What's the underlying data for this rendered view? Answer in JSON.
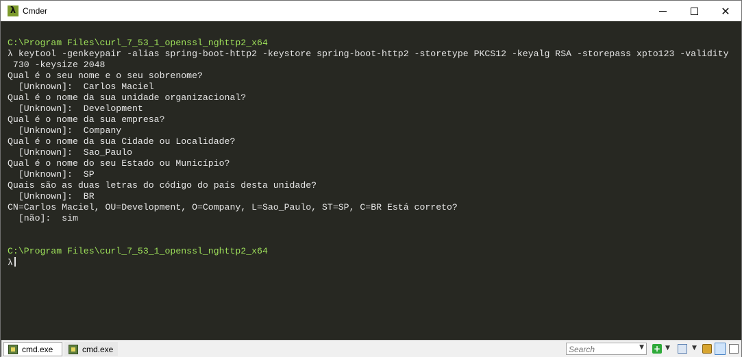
{
  "window": {
    "title": "Cmder",
    "app_icon": "lambda-icon",
    "controls": [
      "minimize-icon",
      "maximize-icon",
      "close-icon"
    ]
  },
  "terminal": {
    "lines": [
      {
        "text": "C:\\Program Files\\curl_7_53_1_openssl_nghttp2_x64",
        "kind": "path"
      },
      {
        "text": "λ keytool -genkeypair -alias spring-boot-http2 -keystore spring-boot-http2 -storetype PKCS12 -keyalg RSA -storepass xpto123 -validity",
        "kind": "cmd"
      },
      {
        "text": " 730 -keysize 2048",
        "kind": "cmd"
      },
      {
        "text": "Qual é o seu nome e o seu sobrenome?",
        "kind": "out"
      },
      {
        "text": "  [Unknown]:  Carlos Maciel",
        "kind": "out"
      },
      {
        "text": "Qual é o nome da sua unidade organizacional?",
        "kind": "out"
      },
      {
        "text": "  [Unknown]:  Development",
        "kind": "out"
      },
      {
        "text": "Qual é o nome da sua empresa?",
        "kind": "out"
      },
      {
        "text": "  [Unknown]:  Company",
        "kind": "out"
      },
      {
        "text": "Qual é o nome da sua Cidade ou Localidade?",
        "kind": "out"
      },
      {
        "text": "  [Unknown]:  Sao_Paulo",
        "kind": "out"
      },
      {
        "text": "Qual é o nome do seu Estado ou Município?",
        "kind": "out"
      },
      {
        "text": "  [Unknown]:  SP",
        "kind": "out"
      },
      {
        "text": "Quais são as duas letras do código do país desta unidade?",
        "kind": "out"
      },
      {
        "text": "  [Unknown]:  BR",
        "kind": "out"
      },
      {
        "text": "CN=Carlos Maciel, OU=Development, O=Company, L=Sao_Paulo, ST=SP, C=BR Está correto?",
        "kind": "out"
      },
      {
        "text": "  [não]:  sim",
        "kind": "out"
      },
      {
        "text": "",
        "kind": "blank"
      },
      {
        "text": "",
        "kind": "blank"
      },
      {
        "text": "C:\\Program Files\\curl_7_53_1_openssl_nghttp2_x64",
        "kind": "path"
      },
      {
        "text": "λ",
        "kind": "prompt"
      }
    ],
    "colors": {
      "background": "#272822",
      "text": "#e6e6e6",
      "path": "#9ee05a"
    }
  },
  "statusbar": {
    "tabs": [
      {
        "label": "cmd.exe",
        "active": true
      },
      {
        "label": "cmd.exe",
        "active": false
      }
    ],
    "search_placeholder": "Search"
  }
}
